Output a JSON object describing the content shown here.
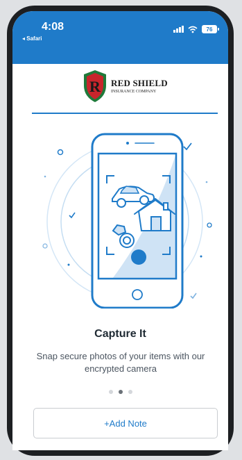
{
  "status_bar": {
    "time": "4:08",
    "back_app": "◂ Safari",
    "battery": "76"
  },
  "logo": {
    "letter": "R",
    "name": "RED SHIELD",
    "subtitle": "INSURANCE COMPANY"
  },
  "onboarding": {
    "title": "Capture It",
    "description": "Snap secure photos of your items with our encrypted camera",
    "page_count": 3,
    "active_page": 2
  },
  "add_note_button": {
    "label": "+Add Note"
  },
  "colors": {
    "primary": "#1f7bc9",
    "shield_red": "#c8252c",
    "shield_green": "#1f7a3a"
  },
  "icons": [
    "signal-icon",
    "wifi-icon",
    "battery-icon",
    "car-icon",
    "house-icon",
    "ring-icon",
    "shutter-icon"
  ]
}
